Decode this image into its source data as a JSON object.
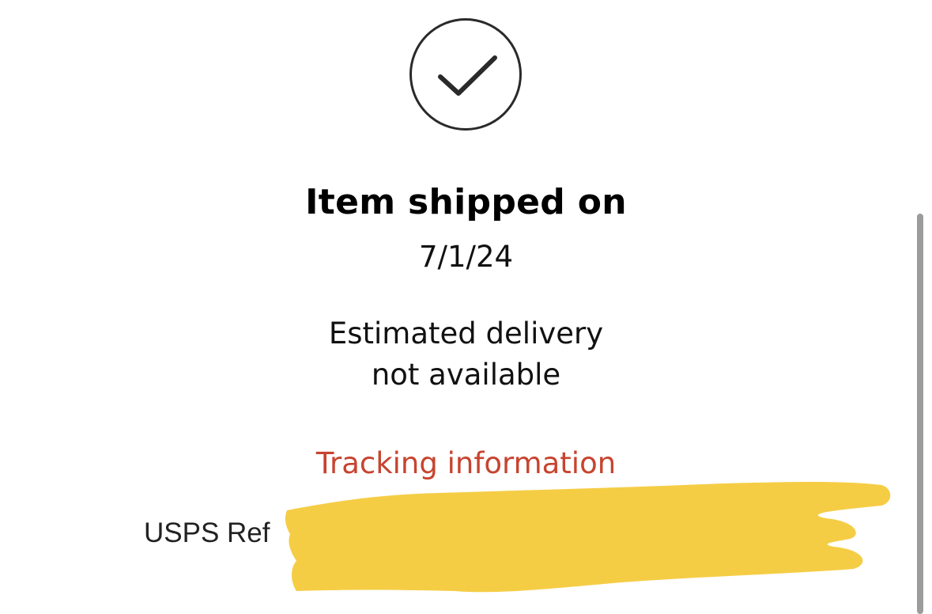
{
  "status_icon": "checkmark-circle-icon",
  "shipment": {
    "title": "Item shipped on",
    "date": "7/1/24",
    "estimate_line1": "Estimated delivery",
    "estimate_line2": "not available"
  },
  "tracking": {
    "link_label": "Tracking information",
    "carrier_ref_label": "USPS Ref"
  },
  "colors": {
    "link": "#c7442f",
    "redaction": "#f5cd45"
  }
}
